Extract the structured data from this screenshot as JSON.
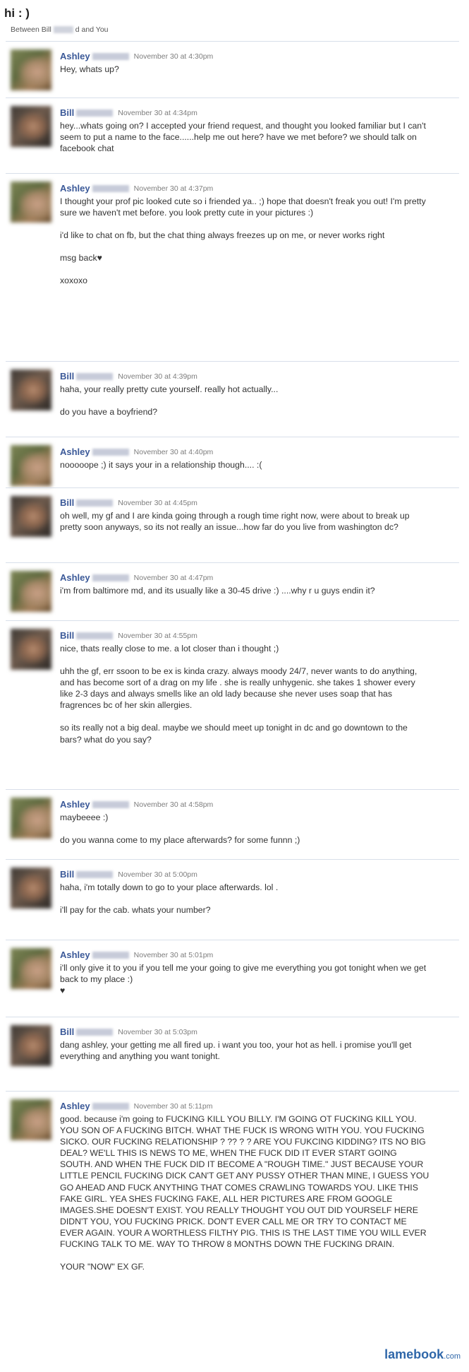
{
  "thread": {
    "title": "hi : )",
    "between_prefix": "Between Bill",
    "between_suffix": "d and You"
  },
  "messages": [
    {
      "sender": "Ashley",
      "time": "November 30 at 4:30pm",
      "paragraphs": [
        "Hey, whats up?"
      ]
    },
    {
      "sender": "Bill",
      "time": "November 30 at 4:34pm",
      "paragraphs": [
        "hey...whats going on? I accepted your friend request, and thought you looked familiar but I can't seem to put a name to the face......help me out here? have we met before? we should talk on facebook chat"
      ]
    },
    {
      "sender": "Ashley",
      "time": "November 30 at 4:37pm",
      "paragraphs": [
        "I thought your prof pic looked cute so i friended ya.. ;) hope that doesn't freak you out! I'm pretty sure we haven't met before. you look pretty cute in your pictures :)",
        "i'd like to chat on fb, but the chat thing always freezes up on me, or never works right",
        "msg back♥",
        "xoxoxo"
      ]
    },
    {
      "sender": "Bill",
      "time": "November 30 at 4:39pm",
      "paragraphs": [
        "haha, your really pretty cute yourself. really hot actually...",
        "do you have a boyfriend?"
      ]
    },
    {
      "sender": "Ashley",
      "time": "November 30 at 4:40pm",
      "paragraphs": [
        "nooooope ;) it says your in a relationship though.... :("
      ]
    },
    {
      "sender": "Bill",
      "time": "November 30 at 4:45pm",
      "paragraphs": [
        "oh well, my gf and I are kinda going through a rough time right now, were about to break up pretty soon anyways, so its not really an issue...how far do you live from washington dc?"
      ]
    },
    {
      "sender": "Ashley",
      "time": "November 30 at 4:47pm",
      "paragraphs": [
        "i'm from baltimore md, and its usually like a 30-45 drive :) ....why r u guys endin it?"
      ]
    },
    {
      "sender": "Bill",
      "time": "November 30 at 4:55pm",
      "paragraphs": [
        "nice, thats really close to me. a lot closer than i thought ;)",
        "uhh the gf, err ssoon to be ex is kinda crazy. always moody 24/7, never wants to do anything, and has become sort of a drag on my life . she is really unhygenic. she takes 1 shower every like 2-3 days and always smells like an old lady because she never uses soap that has fragrences bc of her skin allergies.",
        "so its really not a big deal. maybe we should meet up tonight in dc and go downtown to the bars? what do you say?"
      ]
    },
    {
      "sender": "Ashley",
      "time": "November 30 at 4:58pm",
      "paragraphs": [
        "maybeeee :)",
        "do you wanna come to my place afterwards? for some funnn ;)"
      ]
    },
    {
      "sender": "Bill",
      "time": "November 30 at 5:00pm",
      "paragraphs": [
        "haha, i'm totally down to go to your place afterwards. lol .",
        "i'll pay for the cab. whats your number?"
      ]
    },
    {
      "sender": "Ashley",
      "time": "November 30 at 5:01pm",
      "paragraphs": [
        "i'll only give it to you if you tell me your going to give me everything you got tonight when we get back to my place :)\n♥"
      ]
    },
    {
      "sender": "Bill",
      "time": "November 30 at 5:03pm",
      "paragraphs": [
        "dang ashley, your getting me all fired up. i want you too, your hot as hell. i promise you'll get everything and anything you want tonight."
      ]
    },
    {
      "sender": "Ashley",
      "time": "November 30 at 5:11pm",
      "paragraphs": [
        "good. because i'm going to FUCKING KILL YOU BILLY. I'M GOING OT FUCKING KILL YOU. YOU SON OF A FUCKING BITCH. WHAT THE FUCK IS WRONG WITH YOU. YOU FUCKING SICKO. OUR FUCKING RELATIONSHIP ? ?? ? ? ARE YOU FUKCING KIDDING? ITS NO BIG DEAL? WE'LL THIS IS NEWS TO ME, WHEN THE FUCK DID IT EVER START GOING SOUTH. AND WHEN THE FUCK DID IT BECOME A \"ROUGH TIME.\" JUST BECAUSE YOUR LITTLE PENCIL FUCKING DICK CAN'T GET ANY PUSSY OTHER THAN MINE, I GUESS YOU GO AHEAD AND FUCK ANYTHING THAT COMES CRAWLING TOWARDS YOU. LIKE THIS FAKE GIRL. YEA SHES FUCKING FAKE, ALL HER PICTURES ARE FROM GOOGLE IMAGES.SHE DOESN'T EXIST. YOU REALLY THOUGHT YOU OUT DID YOURSELF HERE DIDN'T YOU, YOU FUCKING PRICK. DON'T EVER CALL ME OR TRY TO CONTACT ME EVER AGAIN. YOUR A WORTHLESS FILTHY PIG. THIS IS THE LAST TIME YOU WILL EVER FUCKING TALK TO ME. WAY TO THROW 8 MONTHS DOWN THE FUCKING DRAIN.",
        "YOUR \"NOW\" EX GF."
      ]
    }
  ],
  "watermark": {
    "brand": "lamebook",
    "suffix": ".com"
  }
}
